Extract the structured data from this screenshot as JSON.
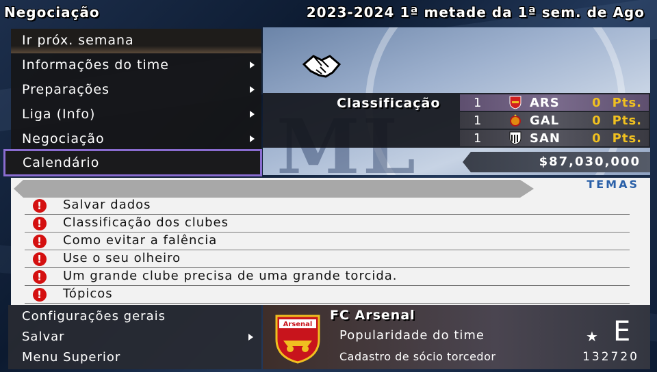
{
  "header": {
    "title": "Negociação",
    "date": "2023-2024 1ª metade da 1ª sem. de Ago"
  },
  "menu": {
    "items": [
      {
        "label": "Ir próx. semana",
        "has_arrow": false
      },
      {
        "label": "Informações do time",
        "has_arrow": true
      },
      {
        "label": "Preparações",
        "has_arrow": true
      },
      {
        "label": "Liga (Info)",
        "has_arrow": true
      },
      {
        "label": "Negociação",
        "has_arrow": true
      },
      {
        "label": "Calendário",
        "has_arrow": false,
        "selected": true
      }
    ]
  },
  "standings": {
    "title": "Classificação",
    "rows": [
      {
        "pos": "1",
        "team": "ARS",
        "pts": "0",
        "pts_label": "Pts.",
        "crest_color": "#d02020"
      },
      {
        "pos": "1",
        "team": "GAL",
        "pts": "0",
        "pts_label": "Pts.",
        "crest_color": "#e08a10"
      },
      {
        "pos": "1",
        "team": "SAN",
        "pts": "0",
        "pts_label": "Pts.",
        "crest_color": "#222222"
      }
    ]
  },
  "finance": {
    "balance": "$87,030,000"
  },
  "topics": {
    "label": "TEMAS",
    "items": [
      "Salvar dados",
      "Classificação dos clubes",
      "Como evitar a falência",
      "Use o seu olheiro",
      "Um grande clube precisa de uma grande torcida.",
      "Tópicos"
    ]
  },
  "bottom_menu": {
    "items": [
      {
        "label": "Configurações gerais",
        "has_arrow": false
      },
      {
        "label": "Salvar",
        "has_arrow": true
      },
      {
        "label": "Menu Superior",
        "has_arrow": false
      }
    ]
  },
  "club": {
    "name": "FC Arsenal",
    "crest_text": "Arsenal",
    "popularity_label": "Popularidade do time",
    "popularity_grade": "E",
    "members_label": "Cadastro de sócio torcedor",
    "members_count": "132720"
  },
  "colors": {
    "selection_border": "#8a6cd0",
    "points": "#f0c020",
    "topic_icon": "#d41010",
    "temas_label": "#2a60a8"
  }
}
